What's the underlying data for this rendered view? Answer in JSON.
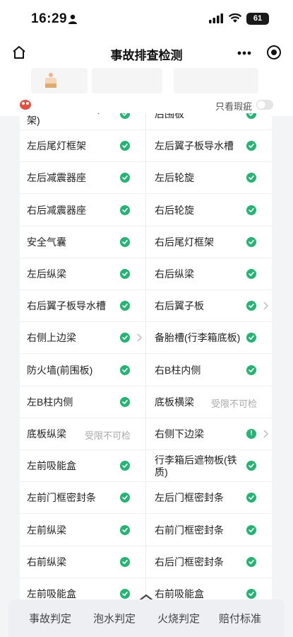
{
  "status_bar": {
    "time": "16:29",
    "battery": "61"
  },
  "nav": {
    "title": "事故排查检测"
  },
  "filter": {
    "label": "只看瑕疵"
  },
  "colors": {
    "check": "#22b573",
    "toggle_off": "#e4e4e4"
  },
  "items_left": [
    {
      "label": "右后翼子板内部(骨架)",
      "status": "check"
    },
    {
      "label": "左后尾灯框架",
      "status": "check"
    },
    {
      "label": "左后减震器座",
      "status": "check"
    },
    {
      "label": "右后减震器座",
      "status": "check"
    },
    {
      "label": "安全气囊",
      "status": "check"
    },
    {
      "label": "左后纵梁",
      "status": "check"
    },
    {
      "label": "右后翼子板导水槽",
      "status": "check"
    },
    {
      "label": "右侧上边梁",
      "status": "check",
      "chevron": true
    },
    {
      "label": "防火墙(前围板)",
      "status": "check"
    },
    {
      "label": "左B柱内侧",
      "status": "check"
    },
    {
      "label": "底板纵梁",
      "status": "text",
      "text": "受限不可检"
    },
    {
      "label": "左前吸能盒",
      "status": "check"
    },
    {
      "label": "左前门框密封条",
      "status": "check"
    },
    {
      "label": "左前纵梁",
      "status": "check"
    },
    {
      "label": "右前纵梁",
      "status": "check"
    },
    {
      "label": "左前吸能盒",
      "status": "check"
    }
  ],
  "items_right": [
    {
      "label": "后围板",
      "status": "check"
    },
    {
      "label": "左后翼子板导水槽",
      "status": "check"
    },
    {
      "label": "左后轮旋",
      "status": "check"
    },
    {
      "label": "右后轮旋",
      "status": "check"
    },
    {
      "label": "右后尾灯框架",
      "status": "check"
    },
    {
      "label": "右后纵梁",
      "status": "check"
    },
    {
      "label": "右后翼子板",
      "status": "check",
      "chevron": true
    },
    {
      "label": "备胎槽(行李箱底板)",
      "status": "check"
    },
    {
      "label": "右B柱内侧",
      "status": "check"
    },
    {
      "label": "底板横梁",
      "status": "text",
      "text": "受限不可检"
    },
    {
      "label": "右侧下边梁",
      "status": "warn",
      "chevron": true
    },
    {
      "label": "行李箱后遮物板(铁质)",
      "status": "check"
    },
    {
      "label": "左后门框密封条",
      "status": "check"
    },
    {
      "label": "右前门框密封条",
      "status": "check"
    },
    {
      "label": "右后门框密封条",
      "status": "check"
    },
    {
      "label": "右前吸能盒",
      "status": "check"
    }
  ],
  "bottom_tabs": [
    "事故判定",
    "泡水判定",
    "火烧判定",
    "赔付标准"
  ]
}
